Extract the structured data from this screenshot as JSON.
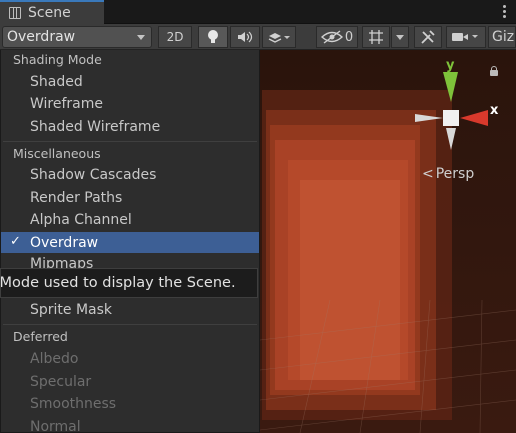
{
  "tab": {
    "title": "Scene"
  },
  "toolbar": {
    "draw_mode": "Overdraw",
    "mode_2d": "2D",
    "hidden_count": "0",
    "gizmos_label": "Giz"
  },
  "scene": {
    "persp_label": "Persp",
    "axis_x": "x",
    "axis_y": "y"
  },
  "menu": {
    "sections": [
      {
        "header": "Shading Mode",
        "items": [
          "Shaded",
          "Wireframe",
          "Shaded Wireframe"
        ]
      },
      {
        "header": "Miscellaneous",
        "items": [
          "Shadow Cascades",
          "Render Paths",
          "Alpha Channel",
          "Overdraw",
          "Mipmaps",
          "Sprite Mask"
        ]
      },
      {
        "header": "Deferred",
        "items": [
          "Albedo",
          "Specular",
          "Smoothness",
          "Normal"
        ]
      }
    ],
    "selected": "Overdraw"
  },
  "tooltip": {
    "text": "Draw Mode used to display the Scene."
  },
  "colors": {
    "selection": "#3d5f95",
    "axis_y": "#7ec23a",
    "axis_x": "#d8392c",
    "scene_fill": "#b5492a"
  }
}
